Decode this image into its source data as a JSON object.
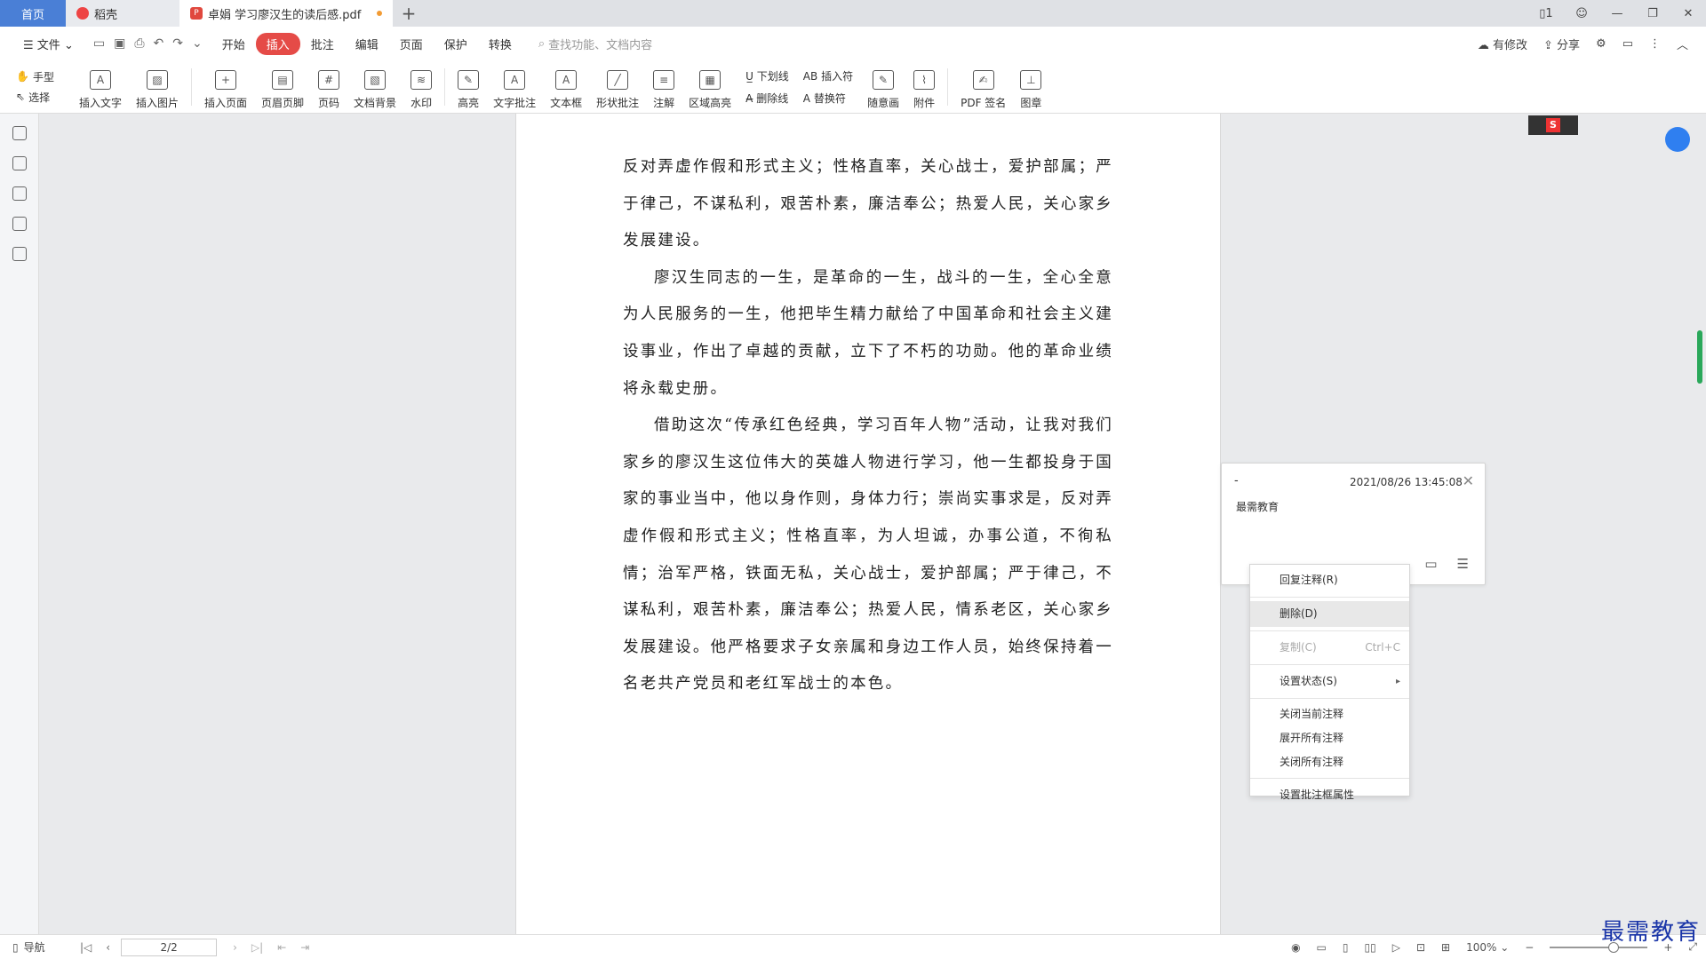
{
  "tabs": {
    "home": "首页",
    "daoke": "稻壳",
    "doc_title": "卓娟 学习廖汉生的读后感.pdf",
    "add": "+"
  },
  "menu": {
    "file": "文件",
    "items": [
      "开始",
      "插入",
      "批注",
      "编辑",
      "页面",
      "保护",
      "转换"
    ],
    "active": "插入",
    "search_placeholder": "查找功能、文档内容",
    "right": [
      "有修改",
      "分享"
    ]
  },
  "ribbon": {
    "hand": "手型",
    "select": "选择",
    "buttons_a": [
      "插入文字",
      "插入图片"
    ],
    "buttons_b": [
      "插入页面",
      "页眉页脚",
      "页码",
      "文档背景",
      "水印"
    ],
    "buttons_c": [
      "高亮",
      "文字批注",
      "文本框",
      "形状批注",
      "注解",
      "区域高亮"
    ],
    "underline": "下划线",
    "strike": "删除线",
    "insert_char": "插入符",
    "replace_char": "替换符",
    "buttons_d": [
      "随意画",
      "附件",
      "PDF 签名",
      "图章"
    ]
  },
  "document": {
    "paragraphs": [
      "反对弄虚作假和形式主义；性格直率，关心战士，爱护部属；严于律己，不谋私利，艰苦朴素，廉洁奉公；热爱人民，关心家乡发展建设。",
      "廖汉生同志的一生，是革命的一生，战斗的一生，全心全意为人民服务的一生，他把毕生精力献给了中国革命和社会主义建设事业，作出了卓越的贡献，立下了不朽的功勋。他的革命业绩将永载史册。",
      "借助这次“传承红色经典，学习百年人物”活动，让我对我们家乡的廖汉生这位伟大的英雄人物进行学习，他一生都投身于国家的事业当中，他以身作则，身体力行；崇尚实事求是，反对弄虚作假和形式主义；性格直率，为人坦诚，办事公道，不徇私情；治军严格，铁面无私，关心战士，爱护部属；严于律己，不谋私利，艰苦朴素，廉洁奉公；热爱人民，情系老区，关心家乡发展建设。他严格要求子女亲属和身边工作人员，始终保持着一名老共产党员和老红军战士的本色。"
    ]
  },
  "comment": {
    "dash": "-",
    "time": "2021/08/26 13:45:08",
    "author": "最需教育"
  },
  "context_menu": {
    "reply": "回复注释(R)",
    "delete": "删除(D)",
    "copy": "复制(C)",
    "copy_shortcut": "Ctrl+C",
    "set_status": "设置状态(S)",
    "close_current": "关闭当前注释",
    "expand_all": "展开所有注释",
    "close_all": "关闭所有注释",
    "props": "设置批注框属性"
  },
  "status": {
    "nav": "导航",
    "page": "2/2",
    "zoom": "100%"
  },
  "watermark": "最需教育"
}
